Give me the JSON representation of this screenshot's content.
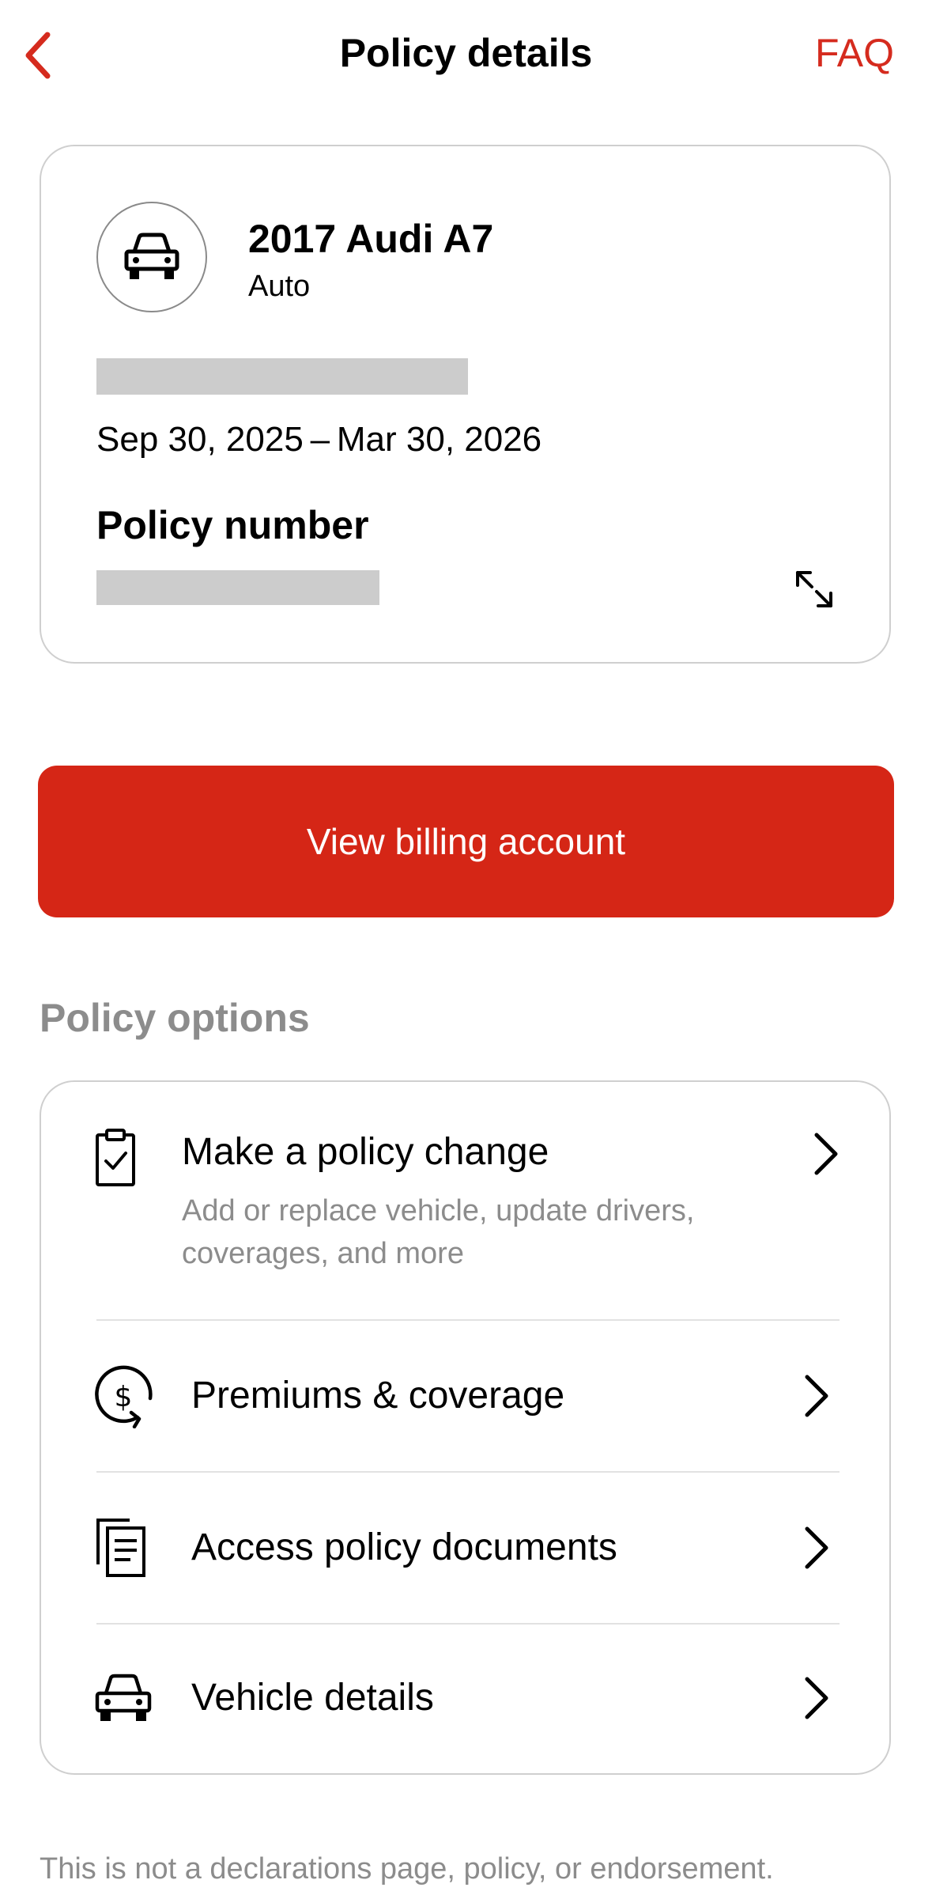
{
  "header": {
    "title": "Policy details",
    "faq_label": "FAQ"
  },
  "vehicle_card": {
    "name": "2017 Audi A7",
    "type": "Auto",
    "dates": "Sep 30, 2025 – Mar 30, 2026",
    "policy_number_label": "Policy number"
  },
  "billing_button_label": "View billing account",
  "policy_options": {
    "title": "Policy options",
    "items": [
      {
        "label": "Make a policy change",
        "sub": "Add or replace vehicle, update drivers, coverages, and more",
        "icon": "clipboard-check-icon"
      },
      {
        "label": "Premiums & coverage",
        "icon": "dollar-cycle-icon"
      },
      {
        "label": "Access policy documents",
        "icon": "documents-icon"
      },
      {
        "label": "Vehicle details",
        "icon": "car-icon"
      }
    ]
  },
  "disclaimer": "This is not a declarations page, policy, or endorsement.",
  "colors": {
    "accent": "#d52616",
    "muted_text": "#8c8c8c",
    "border": "#cfcfcf"
  }
}
